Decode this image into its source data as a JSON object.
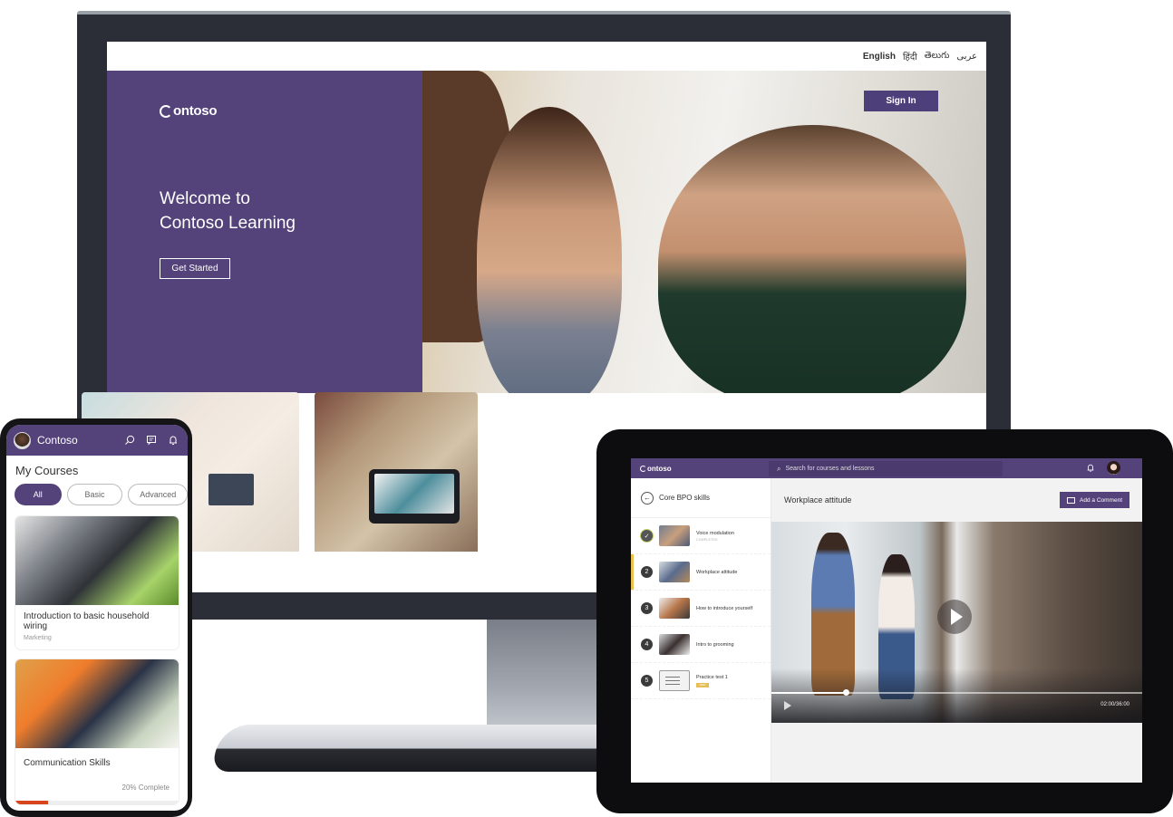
{
  "desktop": {
    "languages": [
      {
        "label": "English",
        "active": true
      },
      {
        "label": "हिंदी",
        "active": false
      },
      {
        "label": "తెలుగు",
        "active": false
      },
      {
        "label": "عربى",
        "active": false
      }
    ],
    "logo": "ontoso",
    "hero_title_line1": "Welcome to",
    "hero_title_line2": "Contoso Learning",
    "get_started_label": "Get Started",
    "sign_in_label": "Sign In"
  },
  "phone": {
    "app_title": "Contoso",
    "icons": [
      "search-icon",
      "chat-icon",
      "bell-icon"
    ],
    "section_title": "My Courses",
    "filters": [
      {
        "label": "All",
        "active": true
      },
      {
        "label": "Basic",
        "active": false
      },
      {
        "label": "Advanced",
        "active": false
      }
    ],
    "courses": [
      {
        "title": "Introduction to basic household wiring",
        "category": "Marketing"
      },
      {
        "title": "Communication Skills",
        "progress_label": "20% Complete",
        "progress": 0.2
      }
    ],
    "accent": "#54427a",
    "progress_color": "#d8451d"
  },
  "tablet": {
    "logo": "ontoso",
    "search_placeholder": "Search for courses and lessons",
    "back_label": "Core BPO skills",
    "lessons": [
      {
        "num": "✓",
        "title": "Voice modulation",
        "status": "COMPLETED",
        "done": true
      },
      {
        "num": "2",
        "title": "Workplace attitude",
        "active": true
      },
      {
        "num": "3",
        "title": "How to introduce yourself"
      },
      {
        "num": "4",
        "title": "Intro to grooming"
      },
      {
        "num": "5",
        "title": "Practice test 1",
        "badge": "NEW"
      }
    ],
    "main_title": "Workplace attitude",
    "add_comment_label": "Add a Comment",
    "video": {
      "current_time": "02:00",
      "duration": "36:00",
      "time_label": "02:00/36:00",
      "progress": 0.2
    },
    "active_accent": "#e8c24c"
  }
}
